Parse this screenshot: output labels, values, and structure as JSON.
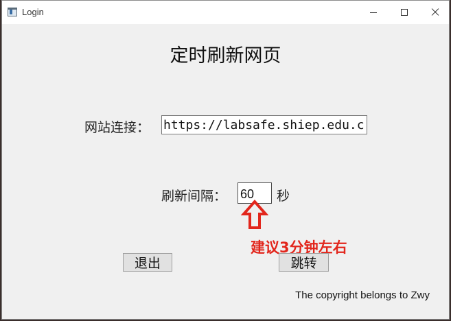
{
  "window": {
    "title": "Login"
  },
  "main": {
    "heading": "定时刷新网页",
    "url_label": "网站连接：",
    "url_value": "https://labsafe.shiep.edu.c",
    "interval_label": "刷新间隔：",
    "interval_value": "60",
    "interval_unit": "秒",
    "annotation": "建议3分钟左右",
    "exit_label": "退出",
    "jump_label": "跳转",
    "copyright": "The copyright belongs to Zwy"
  },
  "colors": {
    "annotation": "#e2261c",
    "window_bg": "#f0f0f0",
    "titlebar_bg": "#ffffff"
  },
  "icons": [
    "app-icon",
    "minimize-icon",
    "maximize-icon",
    "close-icon",
    "up-arrow-icon"
  ]
}
